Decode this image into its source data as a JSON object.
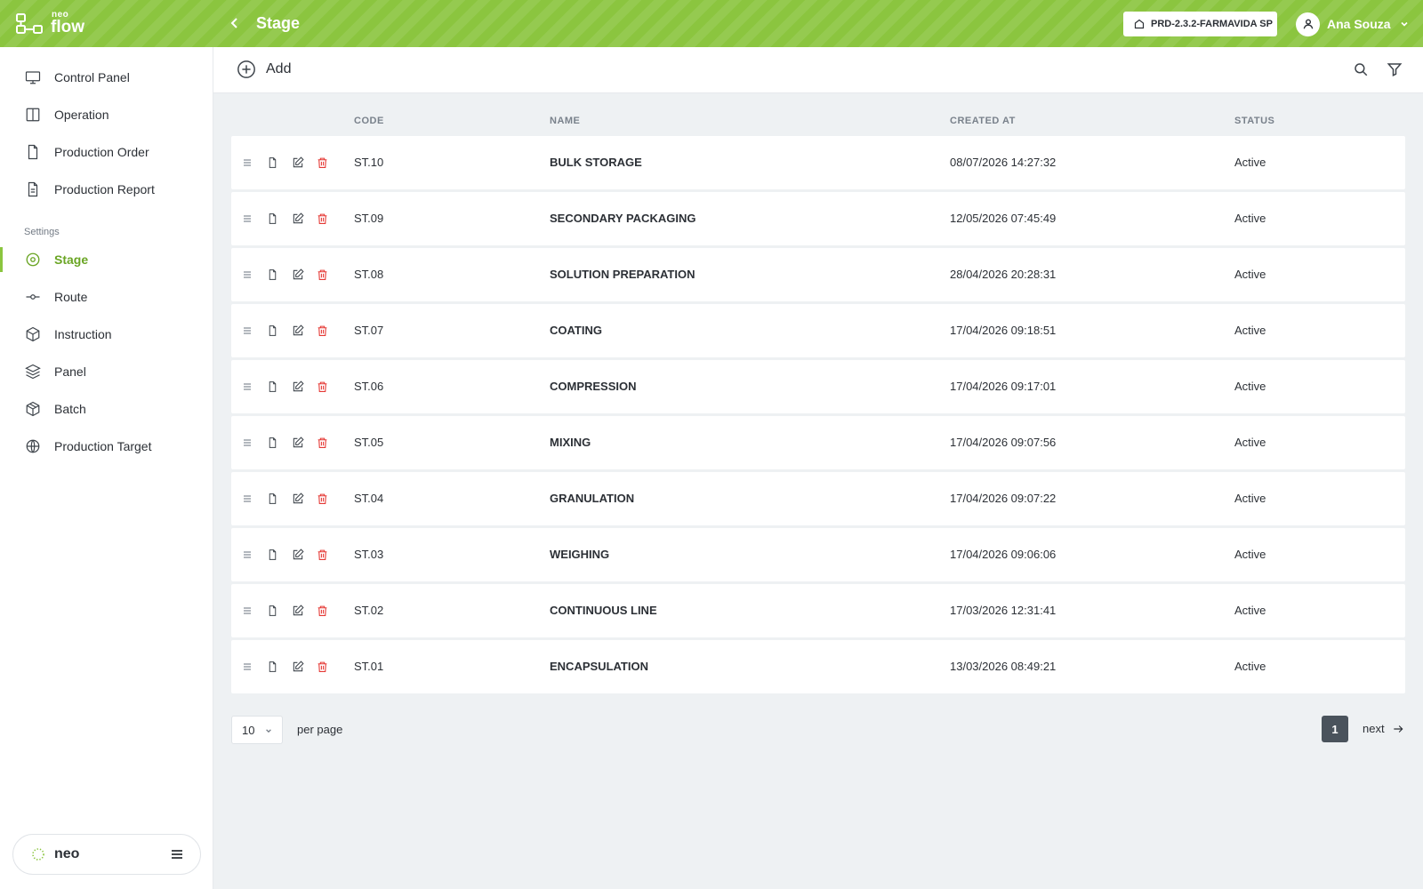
{
  "app": {
    "logo_top": "neo",
    "logo_bottom": "flow",
    "page_title": "Stage"
  },
  "header": {
    "environment": "PRD-2.3.2-FARMAVIDA SP",
    "user_name": "Ana Souza"
  },
  "sidebar": {
    "items": [
      {
        "label": "Control Panel",
        "icon": "monitor-icon"
      },
      {
        "label": "Operation",
        "icon": "columns-icon"
      },
      {
        "label": "Production Order",
        "icon": "file-icon"
      },
      {
        "label": "Production Report",
        "icon": "file-text-icon"
      }
    ],
    "section_label": "Settings",
    "settings_items": [
      {
        "label": "Stage",
        "icon": "target-icon",
        "active": true
      },
      {
        "label": "Route",
        "icon": "git-commit-icon"
      },
      {
        "label": "Instruction",
        "icon": "box-icon"
      },
      {
        "label": "Panel",
        "icon": "layers-icon"
      },
      {
        "label": "Batch",
        "icon": "package-icon"
      },
      {
        "label": "Production Target",
        "icon": "globe-icon"
      }
    ],
    "footer_label": "neo"
  },
  "toolbar": {
    "add_label": "Add"
  },
  "table": {
    "headers": {
      "code": "CODE",
      "name": "NAME",
      "created_at": "CREATED AT",
      "status": "STATUS"
    },
    "rows": [
      {
        "code": "ST.10",
        "name": "BULK STORAGE",
        "created_at": "08/07/2026 14:27:32",
        "status": "Active"
      },
      {
        "code": "ST.09",
        "name": "SECONDARY PACKAGING",
        "created_at": "12/05/2026 07:45:49",
        "status": "Active"
      },
      {
        "code": "ST.08",
        "name": "SOLUTION PREPARATION",
        "created_at": "28/04/2026 20:28:31",
        "status": "Active"
      },
      {
        "code": "ST.07",
        "name": "COATING",
        "created_at": "17/04/2026 09:18:51",
        "status": "Active"
      },
      {
        "code": "ST.06",
        "name": "COMPRESSION",
        "created_at": "17/04/2026 09:17:01",
        "status": "Active"
      },
      {
        "code": "ST.05",
        "name": "MIXING",
        "created_at": "17/04/2026 09:07:56",
        "status": "Active"
      },
      {
        "code": "ST.04",
        "name": "GRANULATION",
        "created_at": "17/04/2026 09:07:22",
        "status": "Active"
      },
      {
        "code": "ST.03",
        "name": "WEIGHING",
        "created_at": "17/04/2026 09:06:06",
        "status": "Active"
      },
      {
        "code": "ST.02",
        "name": "CONTINUOUS LINE",
        "created_at": "17/03/2026 12:31:41",
        "status": "Active"
      },
      {
        "code": "ST.01",
        "name": "ENCAPSULATION",
        "created_at": "13/03/2026 08:49:21",
        "status": "Active"
      }
    ]
  },
  "pagination": {
    "per_page_value": "10",
    "per_page_label": "per page",
    "current_page": "1",
    "next_label": "next"
  },
  "colors": {
    "brand": "#8bc53f",
    "active_text": "#6aa524",
    "delete": "#e53935",
    "page_active": "#4a535c"
  }
}
